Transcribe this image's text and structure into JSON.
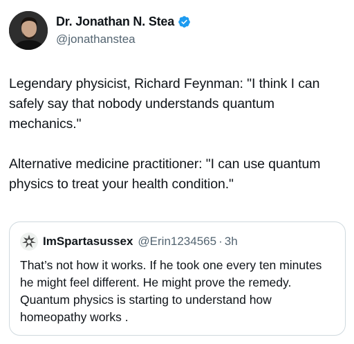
{
  "author": {
    "name": "Dr. Jonathan N. Stea",
    "handle": "@jonathanstea",
    "verified": true
  },
  "tweet": {
    "paragraphs": [
      "Legendary physicist, Richard Feynman: \"I think I can safely say that nobody understands quantum mechanics.\"",
      "Alternative medicine practitioner: \"I can use quantum physics to treat your health condition.\""
    ]
  },
  "quoted_tweet": {
    "name": "ImSpartasussex",
    "handle": "@Erin1234565",
    "separator": "·",
    "time": "3h",
    "text": "That’s not how it works. If he took one every ten minutes he might feel different. He might prove the remedy. Quantum physics is starting to understand how homeopathy works ."
  },
  "colors": {
    "text": "#0f1419",
    "secondary": "#536471",
    "verified_badge": "#1d9bf0",
    "border": "#cfd9de"
  }
}
